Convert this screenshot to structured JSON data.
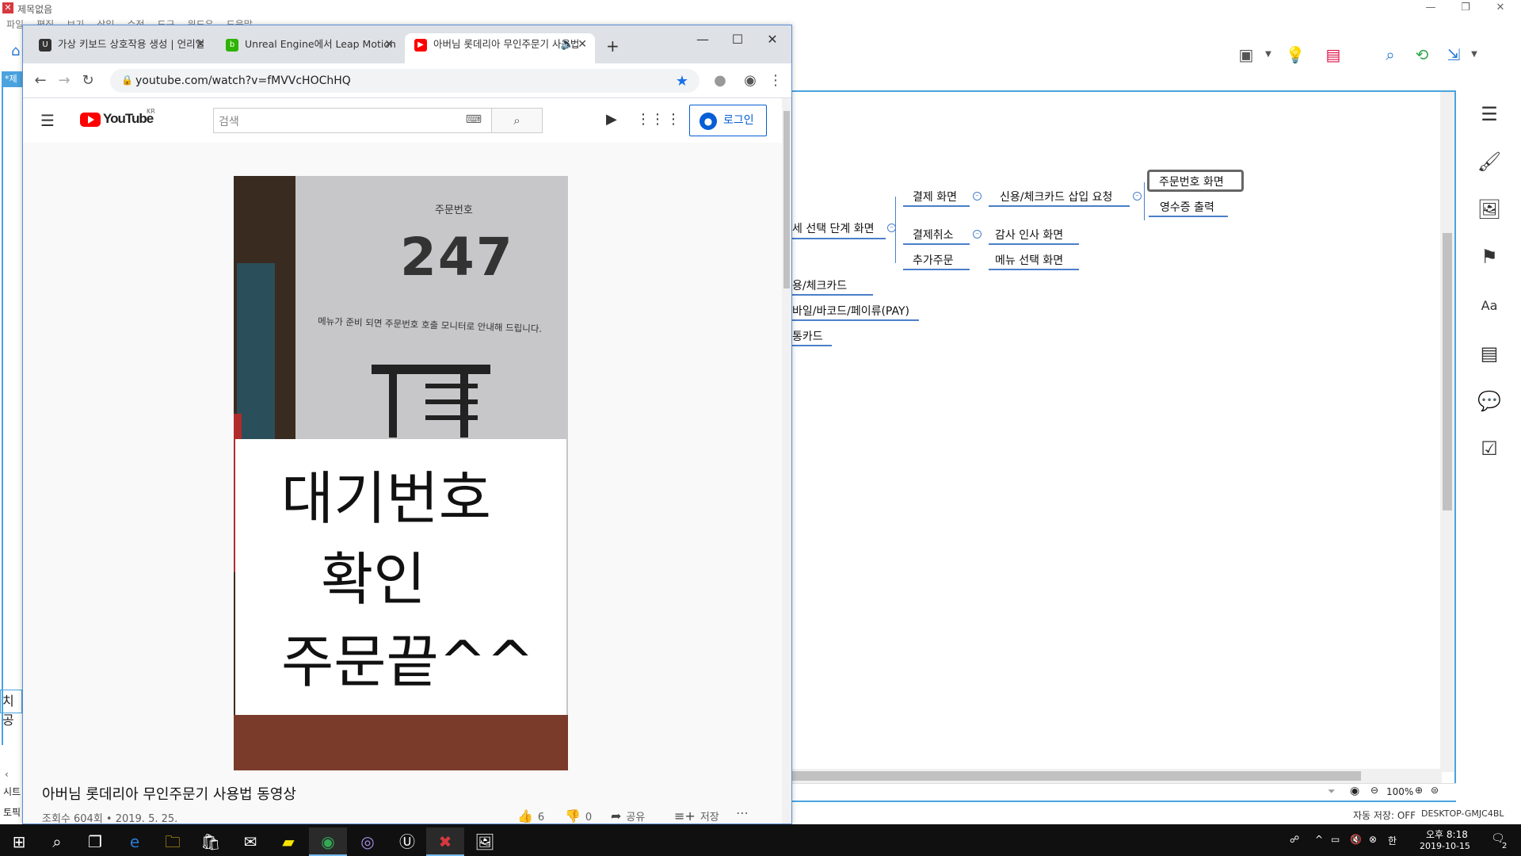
{
  "app": {
    "title": "제목없음",
    "menu": [
      "파일",
      "편집",
      "보기",
      "삽입",
      "수정",
      "도구",
      "윈도우",
      "도움말"
    ],
    "left_labels": {
      "doc_tab": "*제",
      "side_text": "치 공",
      "status_a": "시트",
      "status_b": "토픽"
    },
    "mindmap": {
      "partial_root": "세 선택 단계 화면",
      "partial_items": [
        "용/체크카드",
        "바일/바코드/페이류(PAY)",
        "통카드"
      ],
      "branches": [
        {
          "label": "결제 화면",
          "children": [
            {
              "label": "신용/체크카드 삽입 요청",
              "children": [
                "주문번호 화면",
                "영수증 출력"
              ]
            }
          ]
        },
        {
          "label": "결제취소",
          "children": [
            {
              "label": "감사 인사 화면",
              "children": []
            }
          ]
        },
        {
          "label": "추가주문",
          "children": [
            {
              "label": "메뉴 선택 화면",
              "children": []
            }
          ]
        }
      ]
    },
    "zoom": "100%",
    "autosave": "자동 저장: OFF",
    "computer_name": "DESKTOP-GMJC4BL"
  },
  "chrome": {
    "tabs": [
      {
        "title": "가상 키보드 상호작용 생성 | 언리얼",
        "favicon": "unreal-icon"
      },
      {
        "title": "Unreal Engine에서 Leap Motion",
        "favicon": "naver-blog-icon"
      },
      {
        "title": "아버님 롯데리아 무인주문기 사용법",
        "favicon": "youtube-icon",
        "active": true
      }
    ],
    "url": "youtube.com/watch?v=fMVVcHOChHQ"
  },
  "youtube": {
    "logo_text": "YouTube",
    "logo_region": "KR",
    "search_placeholder": "검색",
    "login_label": "로그인",
    "video": {
      "order_label": "주문번호",
      "order_number": "247",
      "notice": "메뉴가 준비 되면 주문번호 호출 모니터로 안내해 드립니다.",
      "overlay_lines": [
        "대기번호",
        "확인",
        "주문끝^^"
      ]
    },
    "title": "아버님 롯데리아 무인주문기 사용법 동영상",
    "meta": "조회수 604회 • 2019. 5. 25.",
    "likes": "6",
    "dislikes": "0",
    "share_label": "공유",
    "save_label": "저장"
  },
  "taskbar": {
    "time": "오후 8:18",
    "date": "2019-10-15",
    "notification_count": "2"
  }
}
